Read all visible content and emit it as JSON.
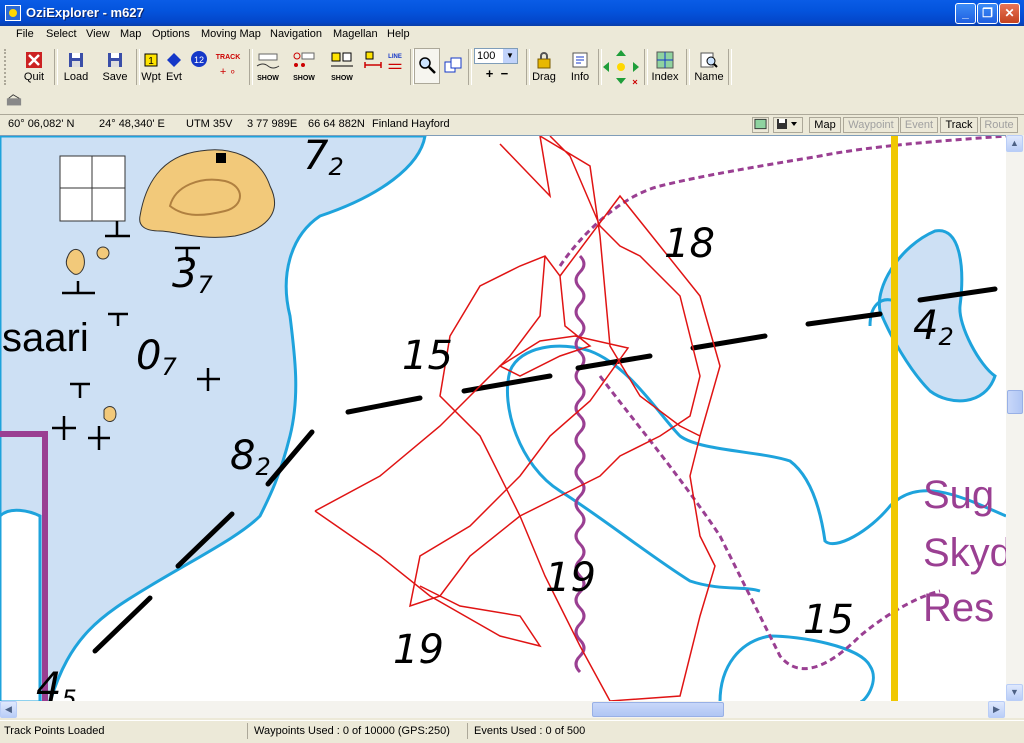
{
  "window": {
    "title": "OziExplorer - m627",
    "min": "_",
    "max": "❐",
    "close": "✕"
  },
  "menu": [
    "File",
    "Select",
    "View",
    "Map",
    "Options",
    "Moving Map",
    "Navigation",
    "Magellan",
    "Help"
  ],
  "toolbar": {
    "quit": "Quit",
    "load": "Load",
    "save": "Save",
    "wpt": "Wpt",
    "evt": "Evt",
    "wpt_icon_text": "1",
    "evt_icon_text": "12",
    "track": "TRACK",
    "show": "SHOW",
    "line": "LINE",
    "zoom": "100",
    "drag": "Drag",
    "info": "Info",
    "index": "Index",
    "name": "Name"
  },
  "position": {
    "lat": "60° 06,082' N",
    "lon": "24° 48,340' E",
    "utm": "UTM  35V",
    "east": "3 77 989E",
    "north": "66 64 882N",
    "datum": "Finland Hayford"
  },
  "mode_buttons": [
    {
      "label": "Map",
      "enabled": true
    },
    {
      "label": "Waypoint",
      "enabled": false
    },
    {
      "label": "Event",
      "enabled": false
    },
    {
      "label": "Track",
      "enabled": true
    },
    {
      "label": "Route",
      "enabled": false
    }
  ],
  "map_labels": {
    "depths": [
      {
        "main": "7",
        "sub": "2"
      },
      {
        "main": "3",
        "sub": "7"
      },
      {
        "main": "0",
        "sub": "7"
      },
      {
        "main": "15",
        "sub": ""
      },
      {
        "main": "18",
        "sub": ""
      },
      {
        "main": "4",
        "sub": "2"
      },
      {
        "main": "8",
        "sub": "2"
      },
      {
        "main": "19",
        "sub": ""
      },
      {
        "main": "19",
        "sub": ""
      },
      {
        "main": "15",
        "sub": ""
      },
      {
        "main": "4",
        "sub": "5"
      }
    ],
    "place": "saari",
    "area_lines": [
      "Sug",
      "Skyd",
      "Res"
    ]
  },
  "status": {
    "message": "Track Points Loaded",
    "waypoints": "Waypoints Used : 0 of 10000  (GPS:250)",
    "events": "Events Used : 0 of 500"
  },
  "colors": {
    "water": "#cde0f4",
    "depth_contour": "#1ea3dc",
    "restricted": "#9a3f92",
    "track": "#e01414",
    "boundary": "#f0c800",
    "land": "#f2c97a"
  }
}
